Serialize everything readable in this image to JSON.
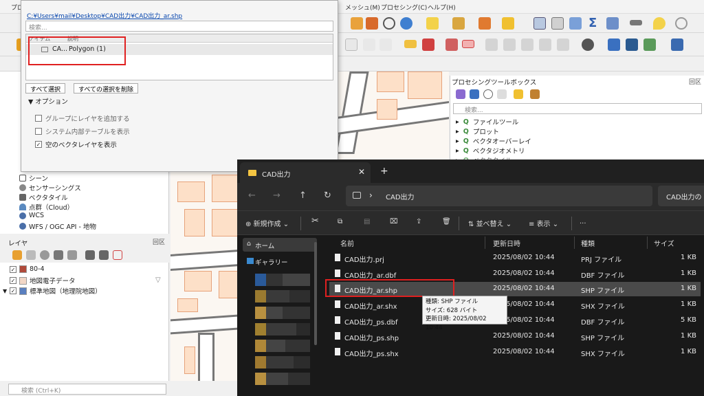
{
  "menubar": {
    "items": [
      "プロ",
      "メッシュ(M)",
      "プロセシング(C)",
      "ヘルプ(H)"
    ]
  },
  "browser": {
    "items": [
      {
        "label": "シーン",
        "icon": "scene-icon"
      },
      {
        "label": "センサーシングス",
        "icon": "sensor-icon"
      },
      {
        "label": "ベクタタイル",
        "icon": "vector-tile-icon"
      },
      {
        "label": "点群（Cloud）",
        "icon": "pointcloud-icon"
      },
      {
        "label": "WCS",
        "icon": "globe-icon"
      },
      {
        "label": "WFS / OGC API - 地物",
        "icon": "globe-icon"
      }
    ]
  },
  "layers": {
    "title": "レイヤ",
    "controls": "回区",
    "items": [
      {
        "label": "80-4",
        "color": "#b04a3a",
        "checked": true
      },
      {
        "label": "地図電子データ",
        "color": "#f2d7c6",
        "checked": true
      },
      {
        "label": "標準地図（地理院地図）",
        "color": "#5a7fbf",
        "checked": true
      }
    ]
  },
  "locator": {
    "placeholder": "検索 (Ctrl+K)"
  },
  "toolbox": {
    "title": "プロセシングツールボックス",
    "controls": "回区",
    "search_placeholder": "検索...",
    "items": [
      "ファイルツール",
      "プロット",
      "ベクタオーバーレイ",
      "ベクタジオメトリ",
      "ベクタタイル"
    ]
  },
  "dialog": {
    "path": "C:¥Users¥mail¥Desktop¥CAD出力¥CAD出力_ar.shp",
    "search_placeholder": "検索...",
    "col_item": "アイテム",
    "col_desc": "説明",
    "row_name": "CA...",
    "row_desc": "Polygon (1)",
    "select_all": "すべて選択",
    "deselect_all": "すべての選択を削除",
    "options_header": "オプション",
    "options": [
      {
        "label": "グループにレイヤを追加する",
        "checked": false
      },
      {
        "label": "システム内部テーブルを表示",
        "checked": false
      },
      {
        "label": "空のベクタレイヤを表示",
        "checked": true
      }
    ]
  },
  "explorer": {
    "tab_title": "CAD出力",
    "breadcrumb": "CAD出力",
    "search_placeholder": "CAD出力の",
    "commands": {
      "new": "新規作成",
      "sort": "並べ替え",
      "view": "表示",
      "more": "..."
    },
    "sidebar": {
      "home": "ホーム",
      "gallery": "ギャラリー"
    },
    "columns": {
      "name": "名前",
      "date": "更新日時",
      "type": "種類",
      "size": "サイズ"
    },
    "files": [
      {
        "name": "CAD出力.prj",
        "date": "2025/08/02 10:44",
        "type": "PRJ ファイル",
        "size": "1 KB"
      },
      {
        "name": "CAD出力_ar.dbf",
        "date": "2025/08/02 10:44",
        "type": "DBF ファイル",
        "size": "1 KB"
      },
      {
        "name": "CAD出力_ar.shp",
        "date": "2025/08/02 10:44",
        "type": "SHP ファイル",
        "size": "1 KB"
      },
      {
        "name": "CAD出力_ar.shx",
        "date": "2025/08/02 10:44",
        "type": "SHX ファイル",
        "size": "1 KB"
      },
      {
        "name": "CAD出力_ps.dbf",
        "date": "2025/08/02 10:44",
        "type": "DBF ファイル",
        "size": "5 KB"
      },
      {
        "name": "CAD出力_ps.shp",
        "date": "2025/08/02 10:44",
        "type": "SHP ファイル",
        "size": "1 KB"
      },
      {
        "name": "CAD出力_ps.shx",
        "date": "2025/08/02 10:44",
        "type": "SHX ファイル",
        "size": "1 KB"
      }
    ],
    "selected_index": 2,
    "tooltip": {
      "line1": "種類: SHP ファイル",
      "line2": "サイズ: 628 バイト",
      "line3": "更新日時: 2025/08/02 10:44"
    }
  },
  "colors": {
    "highlight": "#e02020",
    "explorer_bg": "#191919",
    "building_fill": "#fde0c8"
  }
}
